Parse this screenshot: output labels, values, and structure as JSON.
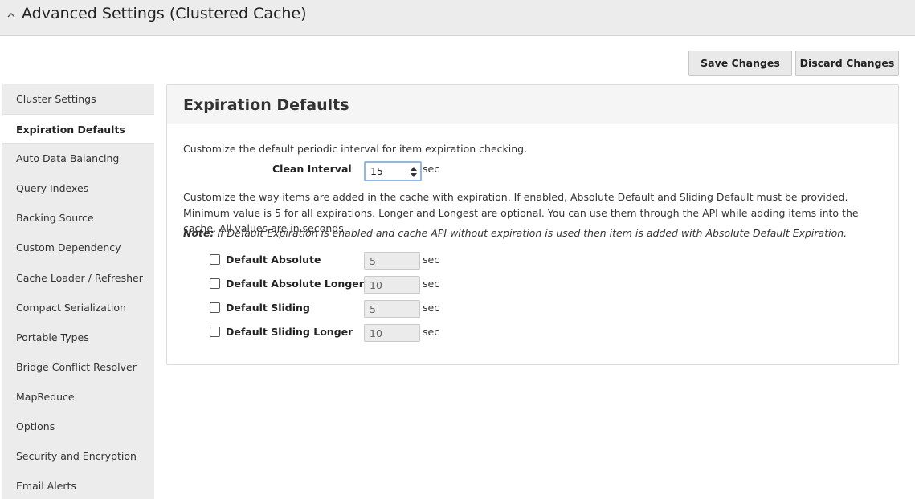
{
  "header": {
    "title": "Advanced Settings (Clustered Cache)",
    "toggle_icon": "chevron-up-icon"
  },
  "toolbar": {
    "save_label": "Save Changes",
    "discard_label": "Discard Changes"
  },
  "sidebar": {
    "active": "Expiration Defaults",
    "items": [
      {
        "label": "Cluster Settings"
      },
      {
        "label": "Expiration Defaults"
      },
      {
        "label": "Auto Data Balancing"
      },
      {
        "label": "Query Indexes"
      },
      {
        "label": "Backing Source"
      },
      {
        "label": "Custom Dependency"
      },
      {
        "label": "Cache Loader / Refresher"
      },
      {
        "label": "Compact Serialization"
      },
      {
        "label": "Portable Types"
      },
      {
        "label": "Bridge Conflict Resolver"
      },
      {
        "label": "MapReduce"
      },
      {
        "label": "Options"
      },
      {
        "label": "Security and Encryption"
      },
      {
        "label": "Email Alerts"
      }
    ]
  },
  "panel": {
    "title": "Expiration Defaults",
    "intro": "Customize the default periodic interval for item expiration checking.",
    "clean_interval": {
      "label": "Clean Interval",
      "value": "15",
      "unit": "sec"
    },
    "description": "Customize the way items are added in the cache with expiration. If enabled, Absolute Default and Sliding Default must be provided. Minimum value is 5 for all expirations. Longer and Longest are optional. You can use them through the API while adding items into the cache. All values are in seconds.",
    "note_label": "Note:",
    "note_text": " If Default Expiration is enabled and cache API without expiration is used then item is added with Absolute Default Expiration.",
    "expirations": [
      {
        "label": "Default Absolute",
        "value": "5",
        "unit": "sec",
        "checked": false
      },
      {
        "label": "Default Absolute Longer",
        "value": "10",
        "unit": "sec",
        "checked": false
      },
      {
        "label": "Default Sliding",
        "value": "5",
        "unit": "sec",
        "checked": false
      },
      {
        "label": "Default Sliding Longer",
        "value": "10",
        "unit": "sec",
        "checked": false
      }
    ]
  }
}
